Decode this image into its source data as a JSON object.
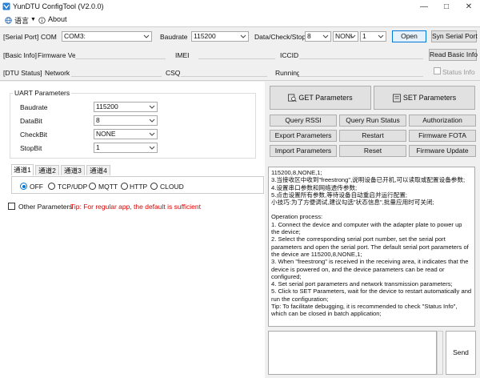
{
  "window": {
    "title": "YunDTU ConfigTool (V2.0.0)"
  },
  "menu": {
    "language": "语言",
    "about": "About"
  },
  "serial_port": {
    "section": "[Serial Port]",
    "com_label": "COM",
    "com_value": "COM3:",
    "baudrate_label": "Baudrate",
    "baudrate_value": "115200",
    "dcs_label": "Data/Check/Stop",
    "data_value": "8",
    "check_value": "NONI",
    "stop_value": "1",
    "open_button": "Open",
    "syn_button": "Syn Serial Port"
  },
  "basic_info": {
    "section": "[Basic Info]",
    "firmware_label": "Firmware Ver",
    "imei_label": "IMEI",
    "iccid_label": "ICCID",
    "read_button": "Read Basic Info"
  },
  "dtu_status": {
    "section": "[DTU Status]",
    "network_label": "Network",
    "csq_label": "CSQ",
    "running_label": "Running",
    "status_info_label": "Status Info"
  },
  "uart": {
    "group_title": "UART Parameters",
    "baudrate_label": "Baudrate",
    "baudrate_value": "115200",
    "databit_label": "DataBit",
    "databit_value": "8",
    "checkbit_label": "CheckBit",
    "checkbit_value": "NONE",
    "stopbit_label": "StopBit",
    "stopbit_value": "1"
  },
  "channels": {
    "tabs": [
      "通道1",
      "通道2",
      "通道3",
      "通道4"
    ],
    "modes": [
      "OFF",
      "TCP/UDP",
      "MQTT",
      "HTTP",
      "CLOUD"
    ]
  },
  "other_params": {
    "label": "Other Parameters",
    "tip": "Tip: For regular app, the default is sufficient"
  },
  "actions": {
    "get_params": "GET Parameters",
    "set_params": "SET Parameters",
    "query_rssi": "Query RSSI",
    "query_run_status": "Query Run Status",
    "authorization": "Authorization",
    "export_params": "Export Parameters",
    "restart": "Restart",
    "firmware_fota": "Firmware FOTA",
    "import_params": "Import Parameters",
    "reset": "Reset",
    "firmware_update": "Firmware Update"
  },
  "log_lines": [
    "115200,8,NONE,1;",
    "3.当接收区中收到\"freestrong\",说明设备已开机,可以读取或配置设备参数;",
    "4.设置串口参数和网络透传参数;",
    "5.点击设置所有参数,等待设备自动重启并运行配置;",
    "小技巧:为了方便调试,建议勾选\"状态信息\",批量应用时可关闭;",
    "",
    "Operation process:",
    "1. Connect the device and computer with the adapter plate to power up the device;",
    "2. Select the corresponding serial port number, set the serial port parameters and open the serial port. The default serial port parameters of the device are 115200,8,NONE,1;",
    "3. When \"freestrong\" is received in the receiving area, it indicates that the device is powered on, and the device parameters can be read or configured;",
    "4. Set serial port parameters and network transmission parameters;",
    "5. Click to SET Parameters, wait for the device to restart automatically and run the configuration;",
    "Tip: To facilitate debugging, it is recommended to check \"Status Info\", which can be closed in batch application;"
  ],
  "send": {
    "button": "Send",
    "input_value": ""
  },
  "colors": {
    "accent": "#0078d7",
    "tip": "#e00000"
  }
}
